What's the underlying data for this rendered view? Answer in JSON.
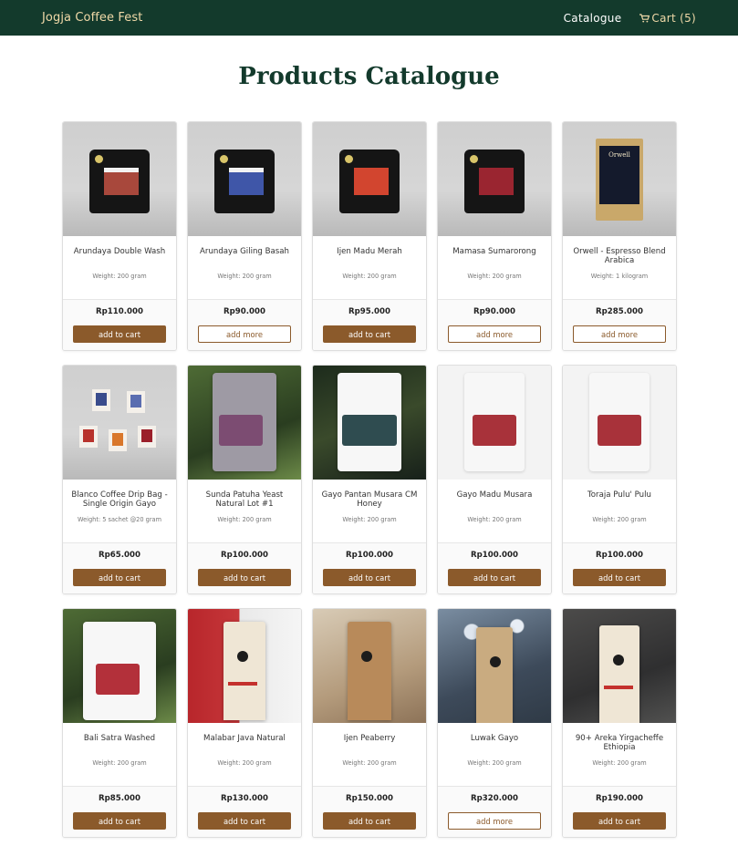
{
  "nav": {
    "brand": "Jogja Coffee Fest",
    "catalogue": "Catalogue",
    "cart": "Cart (5)"
  },
  "page": {
    "title": "Products Catalogue"
  },
  "products": [
    {
      "name": "Arundaya Double Wash",
      "weight": "Weight: 200 gram",
      "price": "Rp110.000",
      "button": "add to cart"
    },
    {
      "name": "Arundaya Giling Basah",
      "weight": "Weight: 200 gram",
      "price": "Rp90.000",
      "button": "add more"
    },
    {
      "name": "Ijen Madu Merah",
      "weight": "Weight: 200 gram",
      "price": "Rp95.000",
      "button": "add to cart"
    },
    {
      "name": "Mamasa Sumarorong",
      "weight": "Weight: 200 gram",
      "price": "Rp90.000",
      "button": "add more"
    },
    {
      "name": "Orwell - Espresso Blend Arabica",
      "weight": "Weight: 1 kilogram",
      "price": "Rp285.000",
      "button": "add more",
      "label": "Orwell"
    },
    {
      "name": "Blanco Coffee Drip Bag - Single Origin Gayo",
      "weight": "Weight: 5 sachet @20 gram",
      "price": "Rp65.000",
      "button": "add to cart"
    },
    {
      "name": "Sunda Patuha Yeast Natural Lot #1",
      "weight": "Weight: 200 gram",
      "price": "Rp100.000",
      "button": "add to cart"
    },
    {
      "name": "Gayo Pantan Musara CM Honey",
      "weight": "Weight: 200 gram",
      "price": "Rp100.000",
      "button": "add to cart"
    },
    {
      "name": "Gayo Madu Musara",
      "weight": "Weight: 200 gram",
      "price": "Rp100.000",
      "button": "add to cart"
    },
    {
      "name": "Toraja Pulu' Pulu",
      "weight": "Weight: 200 gram",
      "price": "Rp100.000",
      "button": "add to cart"
    },
    {
      "name": "Bali Satra Washed",
      "weight": "Weight: 200 gram",
      "price": "Rp85.000",
      "button": "add to cart"
    },
    {
      "name": "Malabar Java Natural",
      "weight": "Weight: 200 gram",
      "price": "Rp130.000",
      "button": "add to cart"
    },
    {
      "name": "Ijen Peaberry",
      "weight": "Weight: 200 gram",
      "price": "Rp150.000",
      "button": "add to cart"
    },
    {
      "name": "Luwak Gayo",
      "weight": "Weight: 200 gram",
      "price": "Rp320.000",
      "button": "add more"
    },
    {
      "name": "90+ Areka Yirgacheffe Ethiopia",
      "weight": "Weight: 200 gram",
      "price": "Rp190.000",
      "button": "add to cart"
    }
  ],
  "colors": {
    "navbar": "#133a2c",
    "brand": "#f0d9a8",
    "accent": "#8b5a2b",
    "title": "#133a2c"
  },
  "icons": {
    "cart": "cart-icon"
  }
}
